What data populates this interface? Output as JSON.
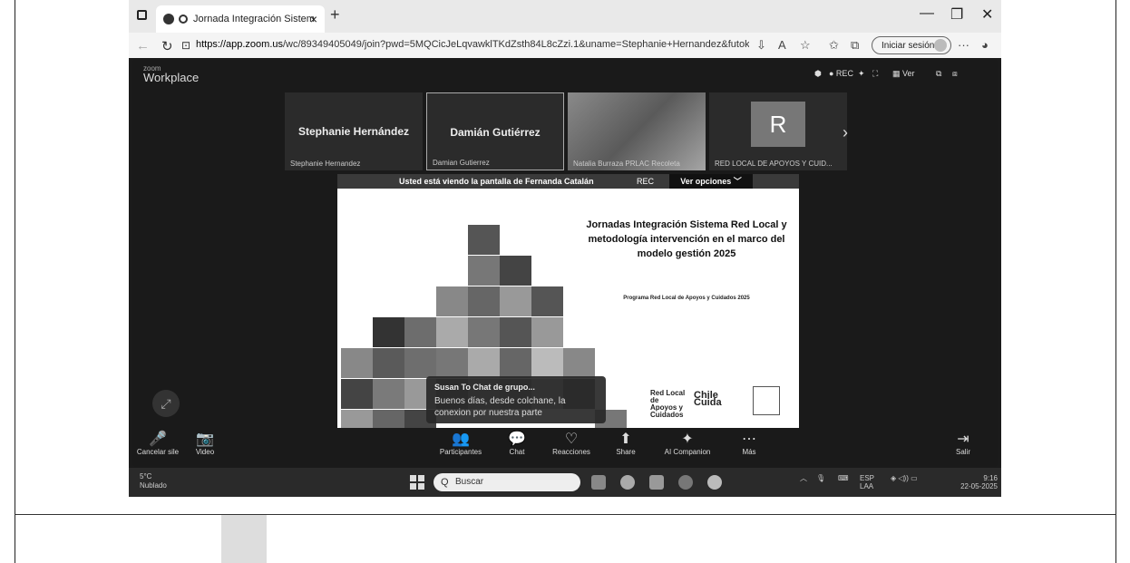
{
  "browser": {
    "tab_title": "Jornada Integración Sistem",
    "tab_close": "×",
    "new_tab": "+",
    "url_host": "https://app.zoom.us",
    "url_rest": "/wc/89349405049/join?pwd=5MQCicJeLqvawklTKdZsth84L8cZzi.1&uname=Stephanie+Hernandez&futoke...",
    "sign_in": "Iniciar sesión",
    "more": "···"
  },
  "zoom": {
    "brand_small": "zoom",
    "brand": "Workplace",
    "rec_top": "● REC",
    "view_label": "Ver",
    "participants": [
      {
        "name": "Stephanie Hernández",
        "sub": "Stephanie Hernandez"
      },
      {
        "name": "Damián Gutiérrez",
        "sub": "Damian Gutierrez"
      },
      {
        "name": "",
        "sub": "Natalia Burraza PRLAC Recoleta"
      },
      {
        "initial": "R",
        "sub": "RED LOCAL DE APOYOS Y CUID..."
      }
    ],
    "share_banner": "Usted está viendo la pantalla de  Fernanda Catalán",
    "share_rec": "REC",
    "view_options": "Ver opciones ﹀",
    "slide": {
      "title": "Jornadas Integración Sistema Red Local y metodología intervención en el marco del modelo gestión 2025",
      "subtitle": "Programa Red Local de Apoyos y Cuidados 2025",
      "logo1": "Red Local de Apoyos y Cuidados",
      "logo2": "Chile Cuida"
    },
    "chat": {
      "header": "Susan To Chat de grupo...",
      "message": "Buenos días, desde colchane, la conexion por nuestra parte"
    },
    "toolbar": [
      {
        "icon": "🎤",
        "label": "Cancelar sile"
      },
      {
        "icon": "📷",
        "label": "Video"
      },
      {
        "icon": "👥",
        "label": "Participantes"
      },
      {
        "icon": "💬",
        "label": "Chat"
      },
      {
        "icon": "♡",
        "label": "Reacciones"
      },
      {
        "icon": "⬆",
        "label": "Share"
      },
      {
        "icon": "✦",
        "label": "AI Companion"
      },
      {
        "icon": "⋯",
        "label": "Más"
      },
      {
        "icon": "⇥",
        "label": "Salir"
      }
    ]
  },
  "taskbar": {
    "weather_temp": "5°C",
    "weather_desc": "Nublado",
    "search": "Buscar",
    "lang": "ESP",
    "lang_sub": "LAA",
    "time": "9:16",
    "date": "22-05-2025"
  }
}
